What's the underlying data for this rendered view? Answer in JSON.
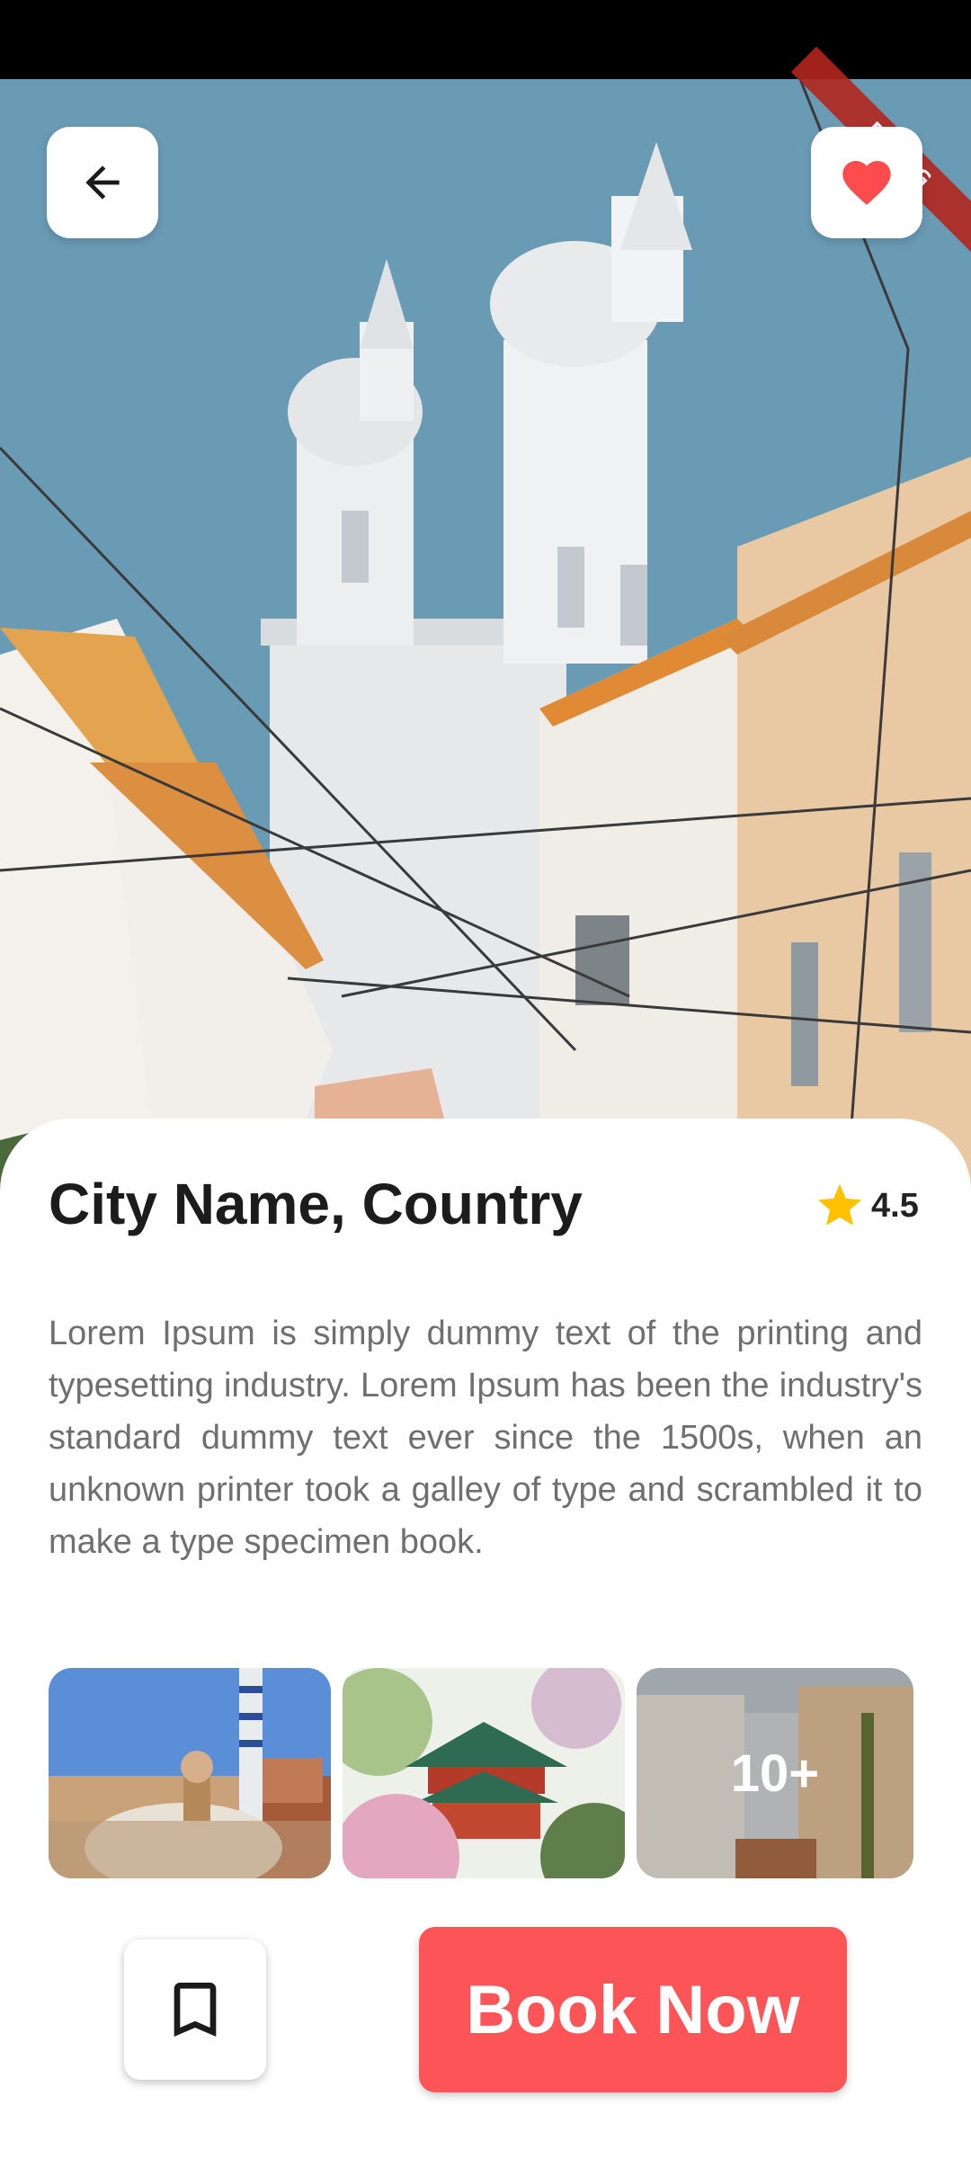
{
  "header": {
    "back_icon": "arrow-left-icon",
    "favorite_icon": "heart-icon",
    "favorite_color": "#fc4c4e",
    "debug_label": "DEBUG"
  },
  "place": {
    "title": "City Name, Country",
    "rating": "4.5",
    "rating_icon": "star-icon",
    "rating_color": "#fdc100",
    "description": "Lorem Ipsum is simply dummy text of the printing and typesetting industry. Lorem Ipsum has been the industry's standard dummy text ever since the 1500s, when an unknown printer took a galley of type and scrambled it to make a type specimen book."
  },
  "gallery": {
    "images": [
      "park-guell-photo",
      "pagoda-photo",
      "street-photo"
    ],
    "more_count": "10+"
  },
  "actions": {
    "bookmark_icon": "bookmark-icon",
    "book_label": "Book Now",
    "book_color": "#fc5457"
  }
}
